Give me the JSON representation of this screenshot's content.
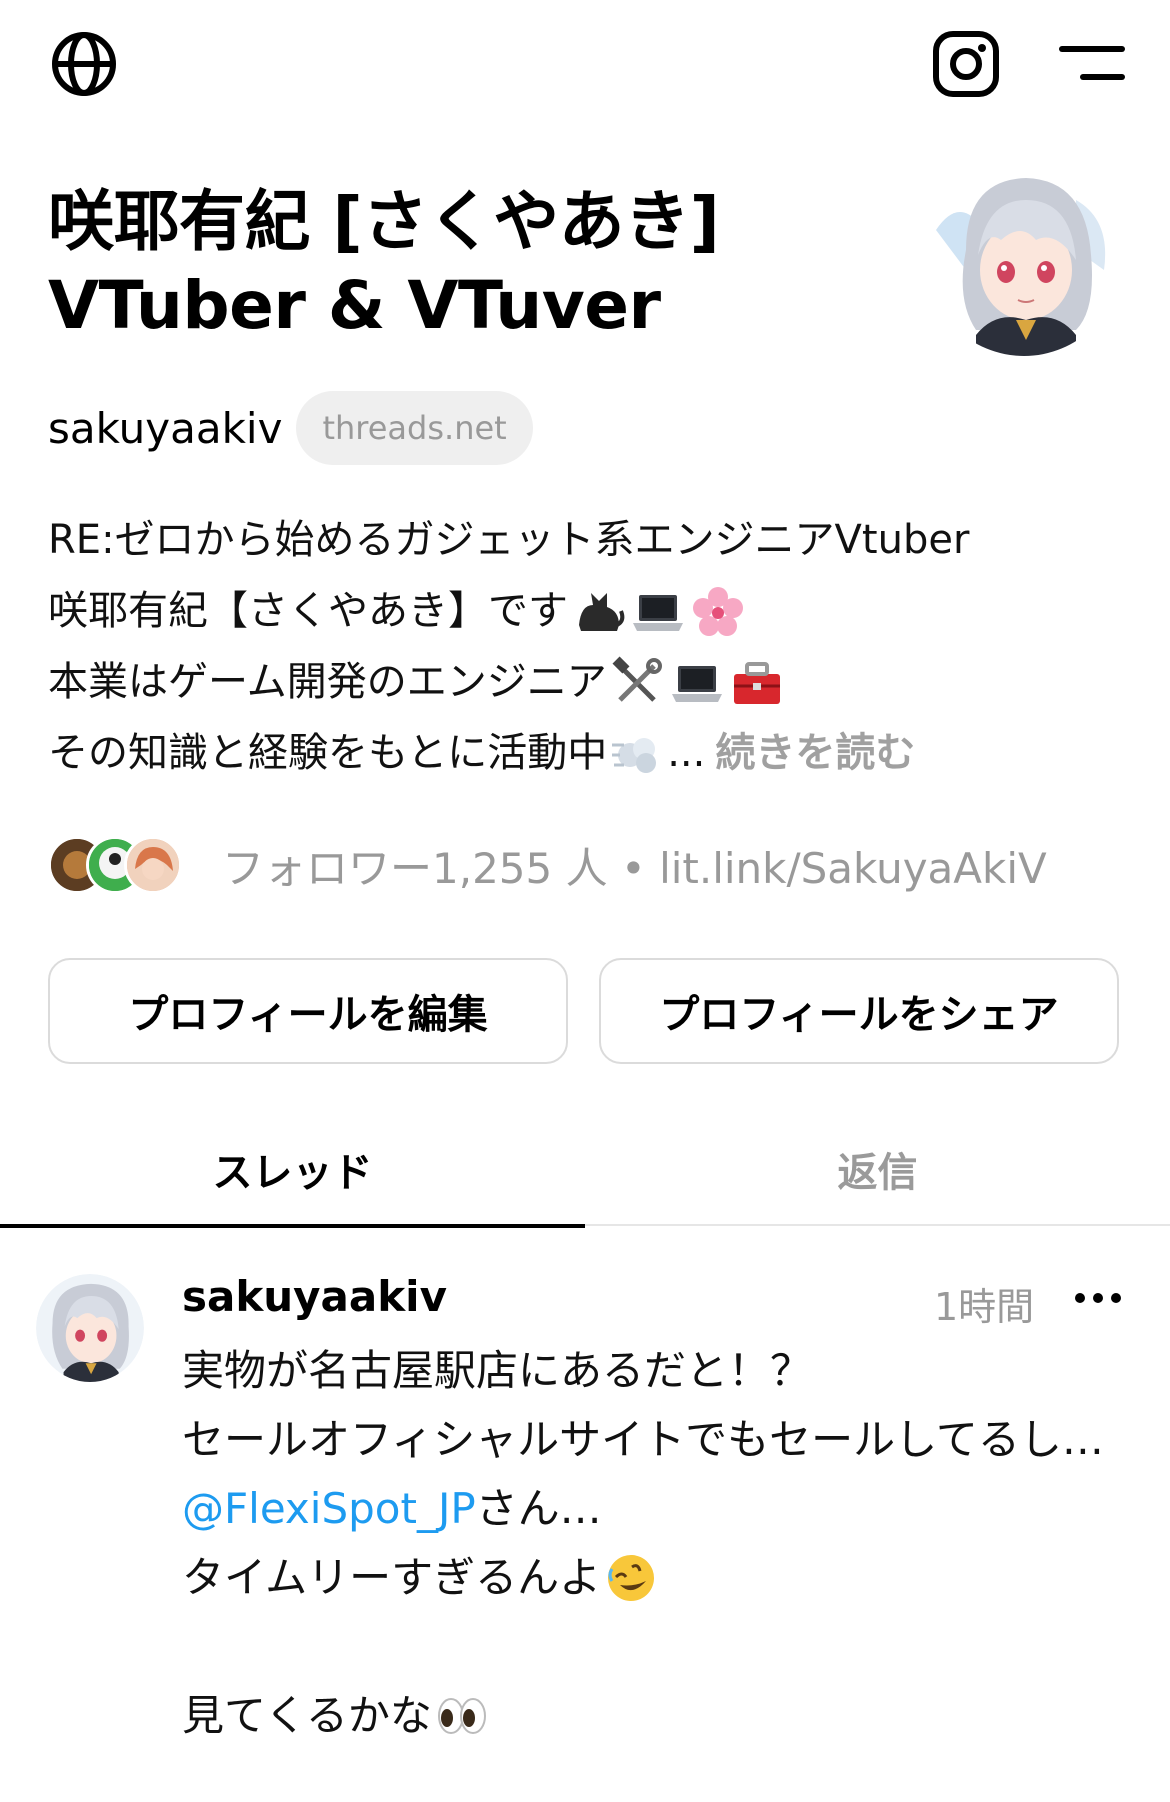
{
  "header": {
    "left_icon": "globe-icon",
    "right_icons": [
      "instagram-icon",
      "menu-icon"
    ]
  },
  "profile": {
    "name_line1": "咲耶有紀 [さくやあき]",
    "name_line2": "VTuber & VTuver",
    "handle": "sakuyaakiv",
    "domain_chip": "threads.net",
    "bio": {
      "line1": "RE:ゼロから始めるガジェット系エンジニアVtuber",
      "line2": "咲耶有紀【さくやあき】です",
      "line2_emojis": [
        "black-cat-emoji",
        "laptop-emoji",
        "cherry-blossom-emoji"
      ],
      "line3": "本業はゲーム開発のエンジニア",
      "line3_emojis": [
        "tools-emoji",
        "laptop-emoji",
        "toolbox-emoji"
      ],
      "line4": "その知識と経験をもとに活動中",
      "line4_emoji": "dash-emoji",
      "line4_ellipsis": "...",
      "read_more": "続きを読む"
    },
    "followers_text": "フォロワー1,255 人 • lit.link/SakuyaAkiV"
  },
  "buttons": {
    "edit_profile": "プロフィールを編集",
    "share_profile": "プロフィールをシェア"
  },
  "tabs": [
    {
      "label": "スレッド",
      "active": true
    },
    {
      "label": "返信",
      "active": false
    }
  ],
  "post": {
    "username": "sakuyaakiv",
    "time": "1時間",
    "more_icon": "more-horizontal-icon",
    "line1": "実物が名古屋駅店にあるだと！？",
    "line2": "セールオフィシャルサイトでもセールしてるし…",
    "mention": "@FlexiSpot_JP",
    "mention_suffix": "さん…",
    "line4": "タイムリーすぎるんよ",
    "line4_emoji": "rolling-laughing-emoji",
    "line6": "見てくるかな",
    "line6_emoji": "eyes-emoji"
  },
  "colors": {
    "text": "#000000",
    "muted": "#999999",
    "link": "#1d9bf0",
    "border": "#dbdbdb",
    "chip_bg": "#efefef"
  }
}
